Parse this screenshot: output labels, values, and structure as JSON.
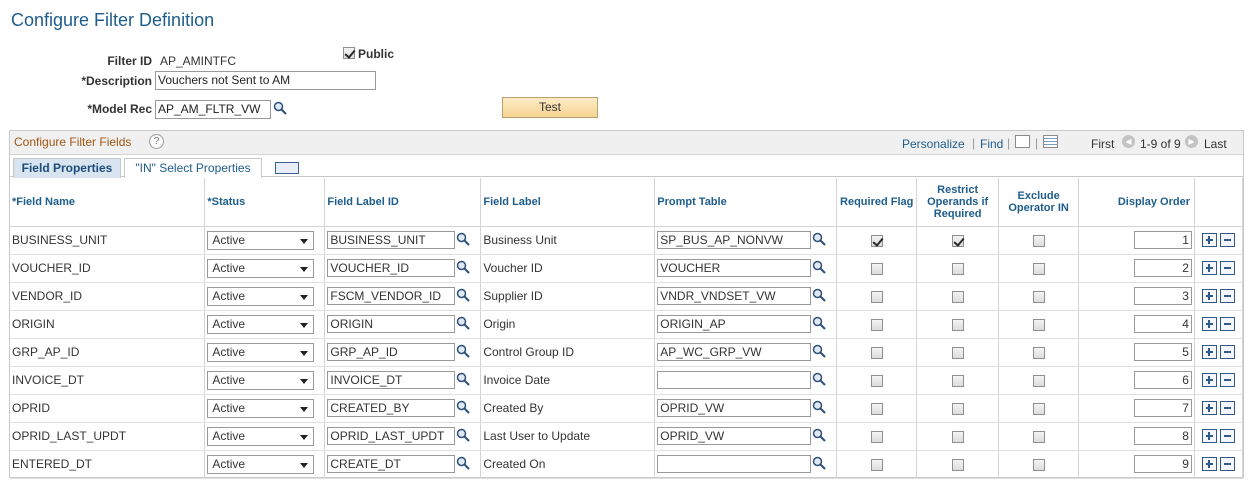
{
  "page_title": "Configure Filter Definition",
  "form": {
    "filter_id_label": "Filter ID",
    "filter_id_value": "AP_AMINTFC",
    "public_label": "Public",
    "public_checked": true,
    "description_label": "*Description",
    "description_value": "Vouchers not Sent to AM",
    "model_rec_label": "*Model Rec",
    "model_rec_value": "AP_AM_FLTR_VW",
    "test_button": "Test"
  },
  "grid": {
    "title": "Configure Filter Fields",
    "help": "?",
    "personalize": "Personalize",
    "find": "Find",
    "first": "First",
    "range": "1-9 of 9",
    "last": "Last",
    "tabs": [
      {
        "label": "Field Properties",
        "active": true
      },
      {
        "label": "\"IN\" Select Properties",
        "active": false
      }
    ],
    "columns": {
      "field_name": "*Field Name",
      "status": "*Status",
      "field_label_id": "Field Label ID",
      "field_label": "Field Label",
      "prompt_table": "Prompt Table",
      "required_flag": "Required Flag",
      "restrict_operands": "Restrict Operands if Required",
      "exclude_operator": "Exclude Operator IN",
      "display_order": "Display Order"
    },
    "rows": [
      {
        "field_name": "BUSINESS_UNIT",
        "status": "Active",
        "label_id": "BUSINESS_UNIT",
        "label": "Business Unit",
        "prompt": "SP_BUS_AP_NONVW",
        "required": true,
        "restrict": true,
        "exclude": false,
        "order": "1"
      },
      {
        "field_name": "VOUCHER_ID",
        "status": "Active",
        "label_id": "VOUCHER_ID",
        "label": "Voucher ID",
        "prompt": "VOUCHER",
        "required": false,
        "restrict": false,
        "exclude": false,
        "order": "2"
      },
      {
        "field_name": "VENDOR_ID",
        "status": "Active",
        "label_id": "FSCM_VENDOR_ID",
        "label": "Supplier ID",
        "prompt": "VNDR_VNDSET_VW",
        "required": false,
        "restrict": false,
        "exclude": false,
        "order": "3"
      },
      {
        "field_name": "ORIGIN",
        "status": "Active",
        "label_id": "ORIGIN",
        "label": "Origin",
        "prompt": "ORIGIN_AP",
        "required": false,
        "restrict": false,
        "exclude": false,
        "order": "4"
      },
      {
        "field_name": "GRP_AP_ID",
        "status": "Active",
        "label_id": "GRP_AP_ID",
        "label": "Control Group ID",
        "prompt": "AP_WC_GRP_VW",
        "required": false,
        "restrict": false,
        "exclude": false,
        "order": "5"
      },
      {
        "field_name": "INVOICE_DT",
        "status": "Active",
        "label_id": "INVOICE_DT",
        "label": "Invoice Date",
        "prompt": "",
        "required": false,
        "restrict": false,
        "exclude": false,
        "order": "6"
      },
      {
        "field_name": "OPRID",
        "status": "Active",
        "label_id": "CREATED_BY",
        "label": "Created By",
        "prompt": "OPRID_VW",
        "required": false,
        "restrict": false,
        "exclude": false,
        "order": "7"
      },
      {
        "field_name": "OPRID_LAST_UPDT",
        "status": "Active",
        "label_id": "OPRID_LAST_UPDT",
        "label": "Last User to Update",
        "prompt": "OPRID_VW",
        "required": false,
        "restrict": false,
        "exclude": false,
        "order": "8"
      },
      {
        "field_name": "ENTERED_DT",
        "status": "Active",
        "label_id": "CREATE_DT",
        "label": "Created On",
        "prompt": "",
        "required": false,
        "restrict": false,
        "exclude": false,
        "order": "9"
      }
    ]
  }
}
